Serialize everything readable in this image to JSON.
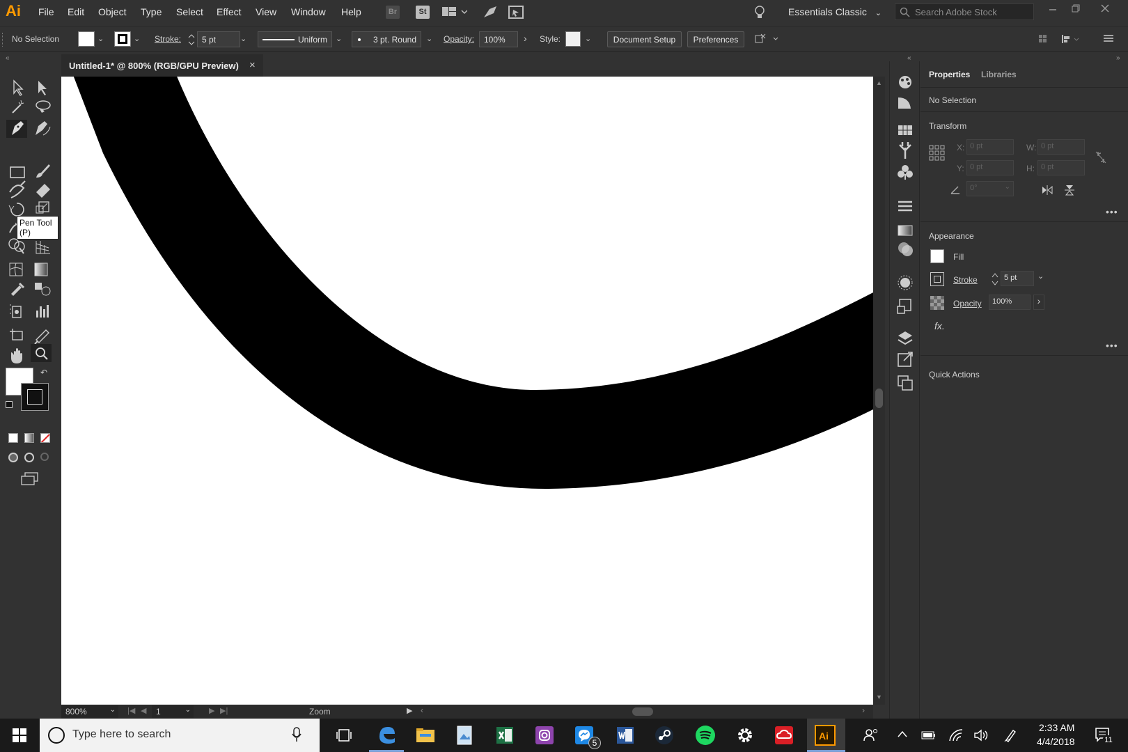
{
  "app": {
    "logo": "Ai",
    "menu": [
      "File",
      "Edit",
      "Object",
      "Type",
      "Select",
      "Effect",
      "View",
      "Window",
      "Help"
    ],
    "bridge_label": "Br",
    "stock_label": "St",
    "workspace": "Essentials Classic",
    "search_placeholder": "Search Adobe Stock"
  },
  "control_bar": {
    "selection": "No Selection",
    "stroke_label": "Stroke:",
    "stroke_value": "5 pt",
    "profile": "Uniform",
    "brush": "3 pt. Round",
    "opacity_label": "Opacity:",
    "opacity_value": "100%",
    "style_label": "Style:",
    "document_setup": "Document Setup",
    "preferences": "Preferences"
  },
  "document": {
    "tab_title": "Untitled-1* @ 800% (RGB/GPU Preview)",
    "close_glyph": "×"
  },
  "toolbar": {
    "tooltip": "Pen Tool (P)"
  },
  "status": {
    "zoom": "800%",
    "artboard": "1",
    "tool": "Zoom"
  },
  "panel": {
    "tabs": [
      "Properties",
      "Libraries"
    ],
    "selection": "No Selection",
    "transform": {
      "title": "Transform",
      "x_label": "X:",
      "x_value": "0 pt",
      "y_label": "Y:",
      "y_value": "0 pt",
      "w_label": "W:",
      "w_value": "0 pt",
      "h_label": "H:",
      "h_value": "0 pt",
      "angle_value": "0°"
    },
    "appearance": {
      "title": "Appearance",
      "fill_label": "Fill",
      "stroke_label": "Stroke",
      "stroke_value": "5 pt",
      "opacity_label": "Opacity",
      "opacity_value": "100%",
      "fx_label": "fx."
    },
    "quick_actions": "Quick Actions"
  },
  "taskbar": {
    "search_placeholder": "Type here to search",
    "messenger_badge": "5",
    "time": "2:33 AM",
    "date": "4/4/2018",
    "notification_count": "11"
  },
  "colors": {
    "ui_bg": "#323232",
    "canvas": "#ffffff",
    "ai_orange": "#ff9a00",
    "taskbar": "#1a1a1a"
  }
}
